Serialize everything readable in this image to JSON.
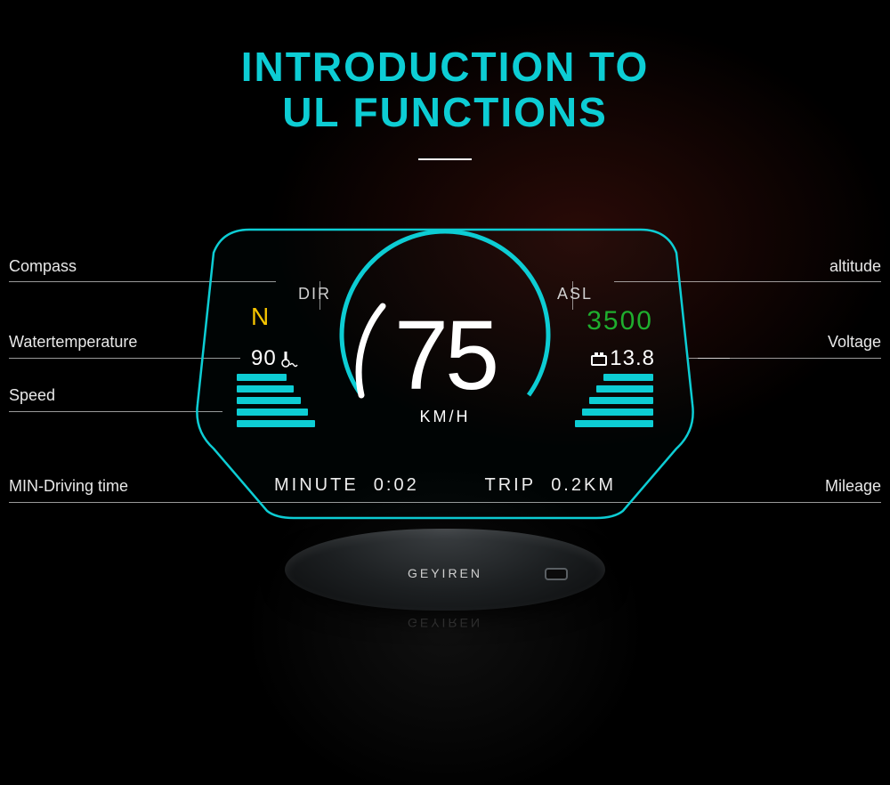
{
  "title": {
    "line1": "INTRODUCTION TO",
    "line2": "UL FUNCTIONS"
  },
  "labels": {
    "compass": "Compass",
    "altitude": "altitude",
    "watertemp": "Watertemperature",
    "voltage": "Voltage",
    "speed": "Speed",
    "driving_time": "MIN-Driving time",
    "mileage": "Mileage"
  },
  "hud": {
    "dir_label": "DIR",
    "dir_value": "N",
    "asl_label": "ASL",
    "asl_value": "3500",
    "wt_value": "90",
    "volt_value": "13.8",
    "speed_value": "75",
    "speed_unit": "KM/H",
    "minute_label": "MINUTE",
    "minute_value": "0:02",
    "trip_label": "TRIP",
    "trip_value": "0.2KM"
  },
  "brand": "GEYIREN"
}
